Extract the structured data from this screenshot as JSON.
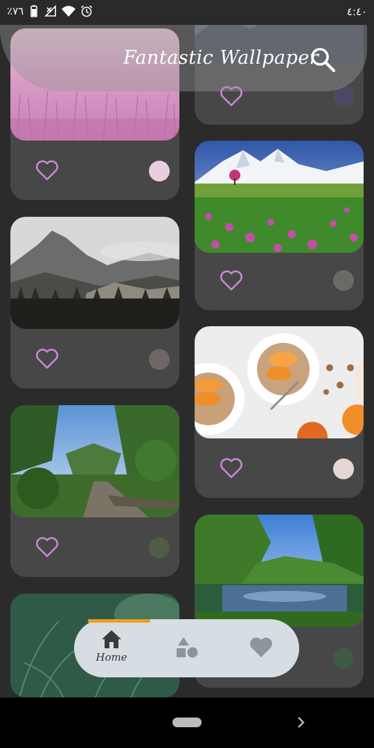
{
  "status_bar": {
    "battery_text": "٪٧٦",
    "time": "٤:٤٠",
    "icons": [
      "battery-icon",
      "no-signal-icon",
      "wifi-icon",
      "alarm-icon"
    ]
  },
  "header": {
    "title": "Fantastic Wallpaper",
    "search_icon": "search-icon"
  },
  "cards": [
    {
      "name": "pink-grass",
      "swatch": "#e8cfe0",
      "favorite": false
    },
    {
      "name": "mountain-lake",
      "swatch": "#4b4a66",
      "favorite": false
    },
    {
      "name": "snowy-mountain-meadow",
      "swatch": "#6b6a66",
      "favorite": false
    },
    {
      "name": "misty-mountains",
      "swatch": "#6d6866",
      "favorite": false
    },
    {
      "name": "fruit-bowls",
      "swatch": "#e6d8d0",
      "favorite": false
    },
    {
      "name": "tropical-path",
      "swatch": "#4e5d45",
      "favorite": false
    },
    {
      "name": "forest-lake",
      "swatch": "#3f5a45",
      "favorite": false
    },
    {
      "name": "green-grass",
      "swatch": "#3b5a48",
      "favorite": false
    }
  ],
  "colors": {
    "background": "#2b2b2b",
    "card": "#474747",
    "heart_outline": "#c989d6",
    "nav_background": "#d6dde3",
    "nav_indicator": "#f29b21"
  },
  "bottom_nav": {
    "items": [
      {
        "icon": "home-icon",
        "label": "Home",
        "active": true
      },
      {
        "icon": "shapes-icon",
        "label": "",
        "active": false
      },
      {
        "icon": "heart-icon",
        "label": "",
        "active": false
      }
    ]
  }
}
